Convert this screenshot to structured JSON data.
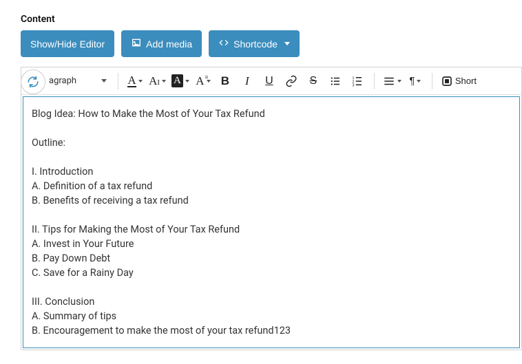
{
  "label": "Content",
  "buttons": {
    "showHide": "Show/Hide Editor",
    "addMedia": "Add media",
    "shortcode": "Shortcode"
  },
  "toolbar": {
    "format": "agraph",
    "short": "Short"
  },
  "editor": {
    "lines": [
      "Blog Idea: How to Make the Most of Your Tax Refund",
      "",
      "Outline:",
      "",
      "I. Introduction",
      "A. Definition of a tax refund",
      "B. Benefits of receiving a tax refund",
      "",
      "II. Tips for Making the Most of Your Tax Refund",
      "A. Invest in Your Future",
      "B. Pay Down Debt",
      "C. Save for a Rainy Day",
      "",
      "III. Conclusion",
      "A. Summary of tips",
      "B. Encouragement to make the most of your tax refund123"
    ]
  }
}
